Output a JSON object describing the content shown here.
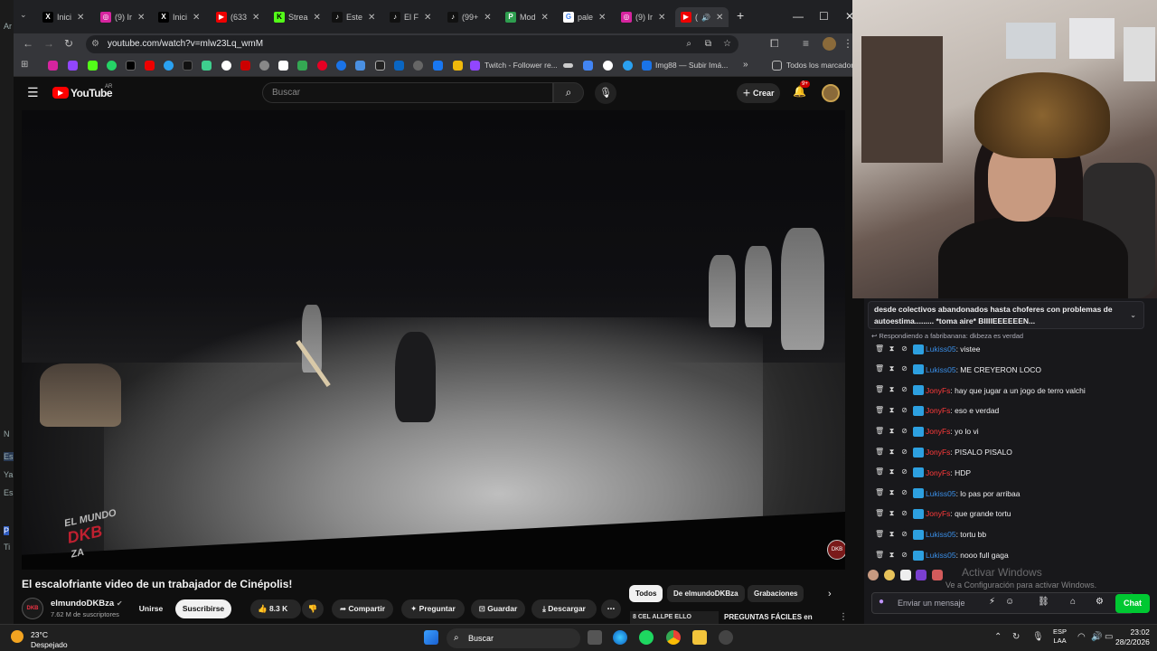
{
  "left_strip": {
    "labels": [
      "Ar",
      "N",
      "Es",
      "Ya",
      "Es",
      "P",
      "Ti"
    ]
  },
  "browser": {
    "tabs": [
      {
        "label": "Inici",
        "icon": "x-icon"
      },
      {
        "label": "(9) Ir",
        "icon": "instagram-icon"
      },
      {
        "label": "Inici",
        "icon": "x-icon"
      },
      {
        "label": "(633",
        "icon": "youtube-icon"
      },
      {
        "label": "Strea",
        "icon": "kick-icon"
      },
      {
        "label": "Este",
        "icon": "tiktok-icon"
      },
      {
        "label": "El F",
        "icon": "tiktok-icon"
      },
      {
        "label": "(99+",
        "icon": "tiktok-icon"
      },
      {
        "label": "Mod",
        "icon": "p-icon"
      },
      {
        "label": "pale",
        "icon": "google-icon"
      },
      {
        "label": "(9) Ir",
        "icon": "instagram-icon"
      },
      {
        "label": "(",
        "icon": "youtube-icon"
      }
    ],
    "url": "youtube.com/watch?v=mlw23Lq_wmM",
    "bookmarks": {
      "twitch_label": "Twitch - Follower re...",
      "img_label": "Img88 — Subir Imá...",
      "all_label": "Todos los marcadores"
    }
  },
  "youtube": {
    "logo": "YouTube",
    "region": "AR",
    "search_placeholder": "Buscar",
    "create_label": "Crear",
    "notif_badge": "9+",
    "video_title": "El escalofriante video de un trabajador de Cinépolis!",
    "watermark": {
      "top": "EL MUNDO",
      "main": "DKB",
      "bottom": "ZA"
    },
    "watermark_badge": "DKB",
    "channel": {
      "name": "elmundoDKBza",
      "subs": "7.62 M de suscriptores",
      "avatar": "DKB"
    },
    "join_label": "Unirse",
    "subscribe_label": "Suscribirse",
    "likes": "8.3 K",
    "share_label": "Compartir",
    "ask_label": "Preguntar",
    "save_label": "Guardar",
    "download_label": "Descargar",
    "chips": [
      "Todos",
      "De elmundoDKBza",
      "Grabaciones"
    ],
    "rec_thumb_text": "8 CEL ALLPE ELLO",
    "rec_title": "PREGUNTAS FÁCILES en"
  },
  "chat": {
    "pinned": "desde colectivos abandonados hasta choferes con problemas de autoestima......... *toma aire* BIIIIEEEEEEN...",
    "replying": "Respondiendo a fabribanana: dkbeza es verdad",
    "messages": [
      {
        "user": "Lukiss05",
        "color": "#3a8ee6",
        "text": ": vistee"
      },
      {
        "user": "Lukiss05",
        "color": "#3a8ee6",
        "text": ": ME CREYERON LOCO"
      },
      {
        "user": "JonyFs",
        "color": "#ff3a3a",
        "text": ": hay que jugar a un jogo de terro valchi"
      },
      {
        "user": "JonyFs",
        "color": "#ff3a3a",
        "text": ": eso e verdad"
      },
      {
        "user": "JonyFs",
        "color": "#ff3a3a",
        "text": ": yo lo vi"
      },
      {
        "user": "JonyFs",
        "color": "#ff3a3a",
        "text": ": PISALO PISALO"
      },
      {
        "user": "JonyFs",
        "color": "#ff3a3a",
        "text": ": HDP"
      },
      {
        "user": "Lukiss05",
        "color": "#3a8ee6",
        "text": ": lo pas por arribaa"
      },
      {
        "user": "JonyFs",
        "color": "#ff3a3a",
        "text": ": que grande tortu"
      },
      {
        "user": "Lukiss05",
        "color": "#3a8ee6",
        "text": ": tortu bb"
      },
      {
        "user": "Lukiss05",
        "color": "#3a8ee6",
        "text": ": nooo full gaga"
      }
    ],
    "activate_title": "Activar Windows",
    "activate_sub": "Ve a Configuración para activar Windows.",
    "input_placeholder": "Enviar un mensaje",
    "chat_button": "Chat"
  },
  "taskbar": {
    "temp": "23°C",
    "weather": "Despejado",
    "search": "Buscar",
    "lang": "ESP",
    "lang2": "LAA",
    "time": "23:02",
    "date": "28/2/2026"
  }
}
